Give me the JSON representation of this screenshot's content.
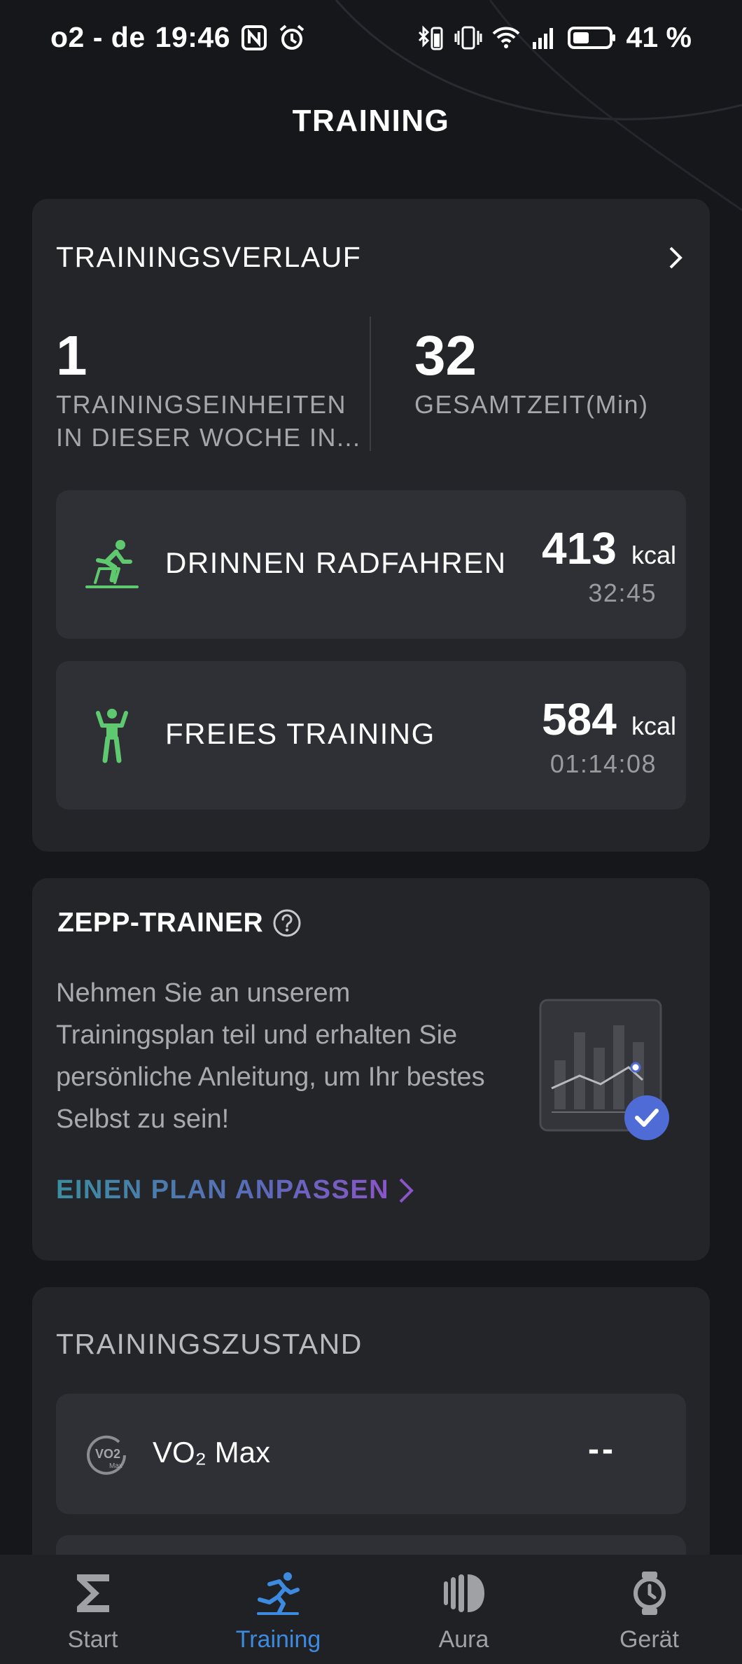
{
  "status_bar": {
    "carrier_time": "o2 - de",
    "time": "19:46",
    "battery_pct": "41 %",
    "icons_left": [
      "nfc-icon",
      "alarm-icon"
    ],
    "icons_right": [
      "bluetooth-battery-icon",
      "vibrate-icon",
      "wifi-icon",
      "signal-icon",
      "battery-icon"
    ]
  },
  "header": {
    "title": "TRAINING"
  },
  "history": {
    "title": "TRAININGSVERLAUF",
    "sessions_value": "1",
    "sessions_label_1": "TRAININGSEINHEITEN",
    "sessions_label_2": "IN DIESER WOCHE IN...",
    "time_value": "32",
    "time_label": "GESAMTZEIT(Min)",
    "workouts": [
      {
        "name": "DRINNEN RADFAHREN",
        "kcal": "413",
        "unit": "kcal",
        "duration": "32:45",
        "icon": "indoor-cycling-icon"
      },
      {
        "name": "FREIES TRAINING",
        "kcal": "584",
        "unit": "kcal",
        "duration": "01:14:08",
        "icon": "free-training-icon"
      }
    ]
  },
  "trainer": {
    "title": "ZEPP-TRAINER",
    "description": "Nehmen Sie an unserem Trainingsplan teil und erhalten Sie persönliche Anleitung, um Ihr bestes Selbst zu sein!",
    "link": "EINEN PLAN ANPASSEN"
  },
  "state": {
    "title": "TRAININGSZUSTAND",
    "vo2_label": "VO₂ Max",
    "vo2_value": "--",
    "vo2_icon_text": "VO2",
    "vo2_icon_sub": "Max"
  },
  "nav": {
    "items": [
      {
        "label": "Start",
        "icon": "sigma-icon"
      },
      {
        "label": "Training",
        "icon": "running-icon"
      },
      {
        "label": "Aura",
        "icon": "aura-icon"
      },
      {
        "label": "Gerät",
        "icon": "watch-icon"
      }
    ],
    "active": "Training"
  },
  "colors": {
    "background": "#16171b",
    "card": "#242529",
    "row": "#2f3035",
    "accent_green": "#5ec96e",
    "accent_blue": "#3d8be0",
    "check_blue": "#4f6bd6"
  }
}
